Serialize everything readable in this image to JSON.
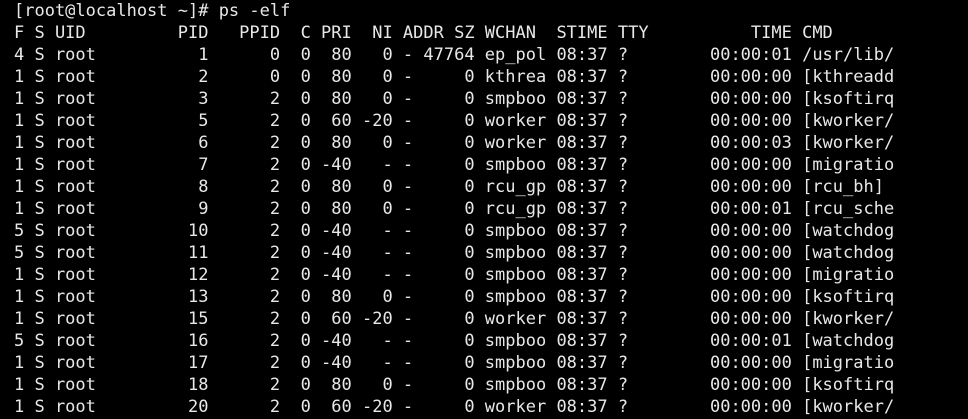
{
  "terminal": {
    "prompt_line": "[root@localhost ~]# ps -elf",
    "header_line": "F S UID         PID   PPID  C PRI  NI ADDR SZ WCHAN  STIME TTY          TIME CMD",
    "rows": [
      "4 S root          1      0  0  80   0 - 47764 ep_pol 08:37 ?        00:00:01 /usr/lib/",
      "1 S root          2      0  0  80   0 -     0 kthrea 08:37 ?        00:00:00 [kthreadd",
      "1 S root          3      2  0  80   0 -     0 smpboo 08:37 ?        00:00:00 [ksoftirq",
      "1 S root          5      2  0  60 -20 -     0 worker 08:37 ?        00:00:00 [kworker/",
      "1 S root          6      2  0  80   0 -     0 worker 08:37 ?        00:00:03 [kworker/",
      "1 S root          7      2  0 -40   - -     0 smpboo 08:37 ?        00:00:00 [migratio",
      "1 S root          8      2  0  80   0 -     0 rcu_gp 08:37 ?        00:00:00 [rcu_bh]",
      "1 S root          9      2  0  80   0 -     0 rcu_gp 08:37 ?        00:00:01 [rcu_sche",
      "5 S root         10      2  0 -40   - -     0 smpboo 08:37 ?        00:00:00 [watchdog",
      "5 S root         11      2  0 -40   - -     0 smpboo 08:37 ?        00:00:00 [watchdog",
      "1 S root         12      2  0 -40   - -     0 smpboo 08:37 ?        00:00:00 [migratio",
      "1 S root         13      2  0  80   0 -     0 smpboo 08:37 ?        00:00:00 [ksoftirq",
      "1 S root         15      2  0  60 -20 -     0 worker 08:37 ?        00:00:00 [kworker/",
      "5 S root         16      2  0 -40   - -     0 smpboo 08:37 ?        00:00:01 [watchdog",
      "1 S root         17      2  0 -40   - -     0 smpboo 08:37 ?        00:00:00 [migratio",
      "1 S root         18      2  0  80   0 -     0 smpboo 08:37 ?        00:00:00 [ksoftirq",
      "1 S root         20      2  0  60 -20 -     0 worker 08:37 ?        00:00:00 [kworker/"
    ]
  }
}
